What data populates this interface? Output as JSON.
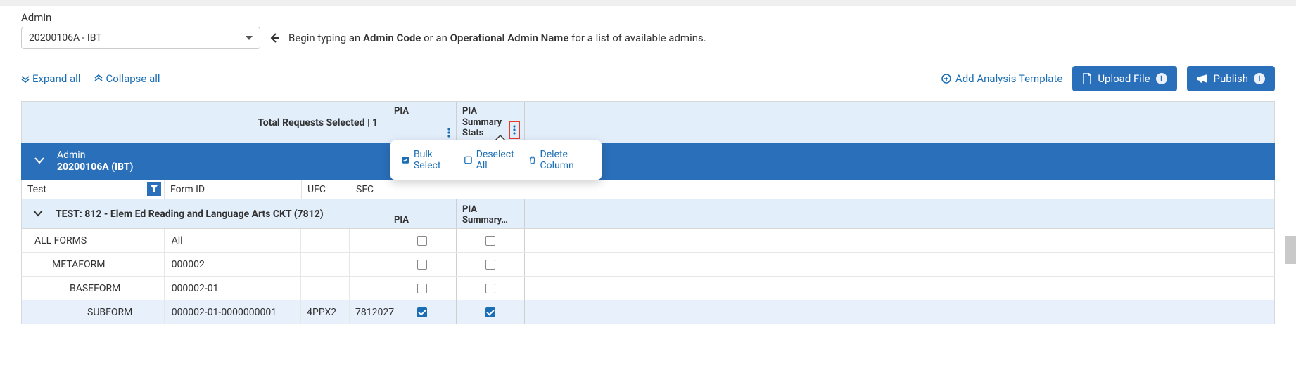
{
  "admin": {
    "label": "Admin",
    "selected": "20200106A - IBT",
    "helper_prefix": "Begin typing an ",
    "helper_b1": "Admin Code",
    "helper_mid": " or an ",
    "helper_b2": "Operational Admin Name",
    "helper_suffix": " for a list of available admins."
  },
  "toolbar": {
    "expand_all": "Expand all",
    "collapse_all": "Collapse all",
    "add_template": "Add Analysis Template",
    "upload_file": "Upload File",
    "publish": "Publish"
  },
  "header_band": {
    "total_requests": "Total Requests Selected | 1",
    "col1": "PIA",
    "col2": "PIA Summary Stats"
  },
  "admin_band": {
    "line1": "Admin",
    "line2": "20200106A (IBT)"
  },
  "columns": {
    "test": "Test",
    "formid": "Form ID",
    "ufc": "UFC",
    "sfc": "SFC"
  },
  "test_band": {
    "title": "TEST: 812 - Elem Ed Reading and Language Arts CKT (7812)",
    "col1": "PIA",
    "col2": "PIA Summary…"
  },
  "rows": [
    {
      "label": "ALL FORMS",
      "formid": "All",
      "ufc": "",
      "sfc": "",
      "pia": false,
      "pia2": false,
      "indent": 0
    },
    {
      "label": "METAFORM",
      "formid": "000002",
      "ufc": "",
      "sfc": "",
      "pia": false,
      "pia2": false,
      "indent": 1
    },
    {
      "label": "BASEFORM",
      "formid": "000002-01",
      "ufc": "",
      "sfc": "",
      "pia": false,
      "pia2": false,
      "indent": 2
    },
    {
      "label": "SUBFORM",
      "formid": "000002-01-0000000001",
      "ufc": "4PPX2",
      "sfc": "7812027",
      "pia": true,
      "pia2": true,
      "indent": 3,
      "highlight": true
    }
  ],
  "popover": {
    "bulk_select": "Bulk Select",
    "deselect_all": "Deselect All",
    "delete_column": "Delete Column"
  }
}
